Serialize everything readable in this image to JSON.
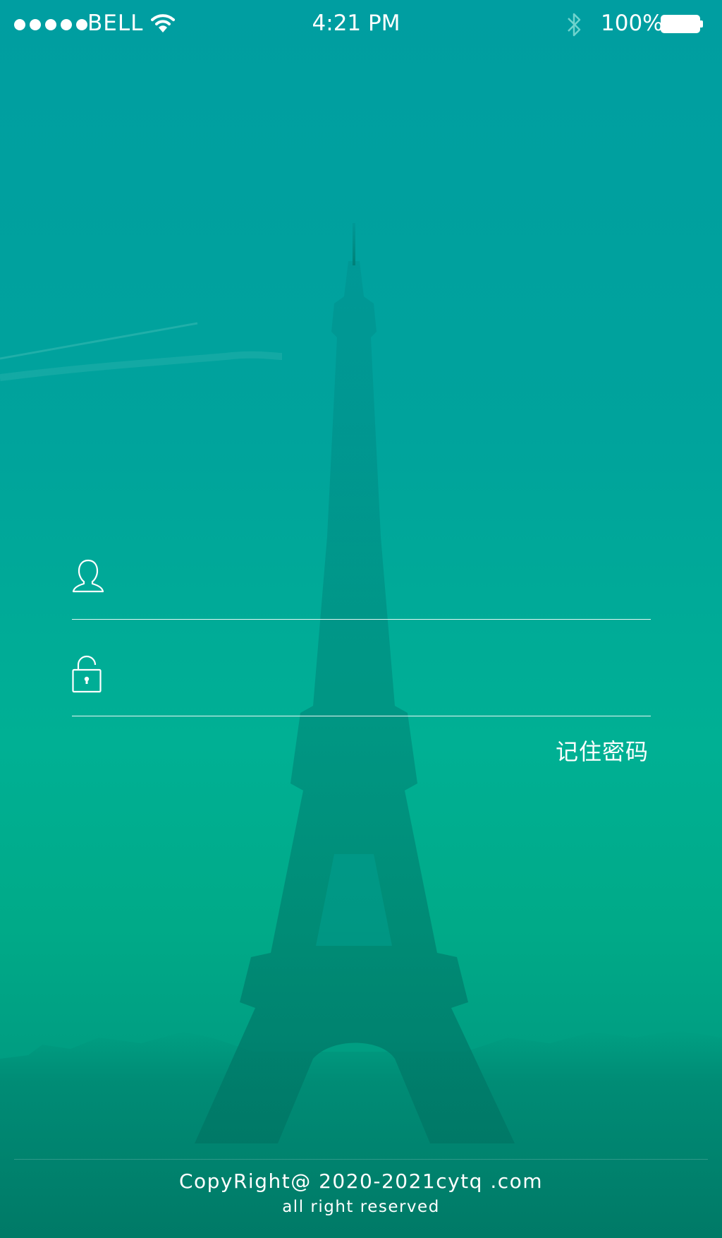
{
  "status_bar": {
    "carrier": "BELL",
    "time": "4:21 PM",
    "battery_percent": "100%",
    "icons": [
      "signal-dots-icon",
      "wifi-icon",
      "bluetooth-icon",
      "battery-icon"
    ]
  },
  "login_form": {
    "username": {
      "icon": "user-icon",
      "value": "",
      "placeholder": ""
    },
    "password": {
      "icon": "lock-icon",
      "value": "",
      "placeholder": ""
    },
    "remember_password_label": "记住密码"
  },
  "footer": {
    "copyright": "CopyRight@ 2020-2021cytq .com",
    "rights": "all right reserved"
  },
  "colors": {
    "background_top": "#009ea1",
    "background_mid": "#00b094",
    "background_bottom": "#00907a",
    "foreground": "#ffffff"
  }
}
